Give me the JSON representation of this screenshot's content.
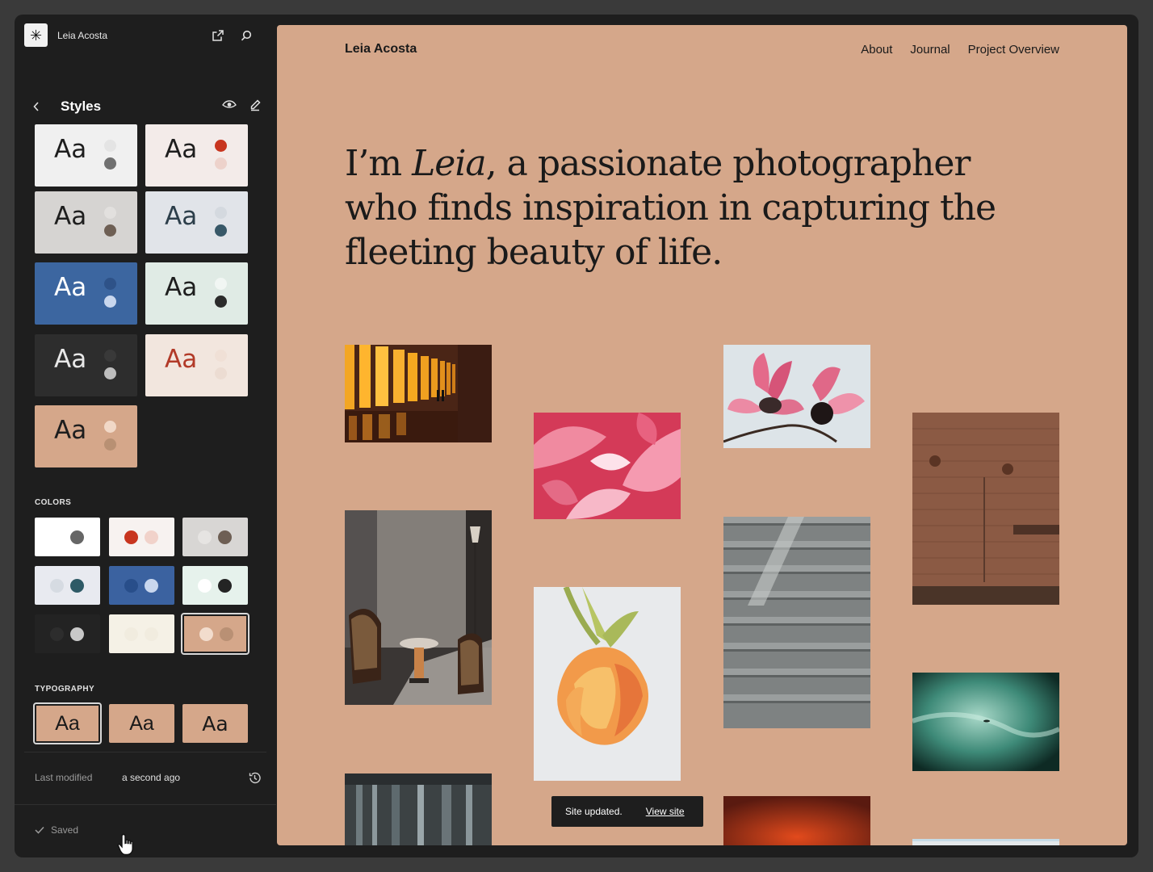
{
  "site": {
    "title": "Leia Acosta"
  },
  "panel": {
    "title": "Styles",
    "variations": [
      {
        "bg": "#f0f0f0",
        "fg": "#1e1e1e",
        "dot1": "#e4e4e4",
        "dot2": "#707070",
        "label": "Aa"
      },
      {
        "bg": "#f3ebe9",
        "fg": "#1e1e1e",
        "dot1": "#c8351f",
        "dot2": "#edd2cb",
        "label": "Aa"
      },
      {
        "bg": "#d6d4d2",
        "fg": "#1e1e1e",
        "dot1": "#e2e0de",
        "dot2": "#6e5f54",
        "label": "Aa"
      },
      {
        "bg": "#e1e4e9",
        "fg": "#2c3e4a",
        "dot1": "#d4d9df",
        "dot2": "#385868",
        "label": "Aa"
      },
      {
        "bg": "#3c66a0",
        "fg": "#ffffff",
        "dot1": "#2e5288",
        "dot2": "#c9d7ee",
        "label": "Aa"
      },
      {
        "bg": "#e0ebe5",
        "fg": "#1e1e1e",
        "dot1": "#f1f6f3",
        "dot2": "#2b2b2b",
        "label": "Aa"
      },
      {
        "bg": "#2d2d2d",
        "fg": "#e8e8e8",
        "dot1": "#393939",
        "dot2": "#bdbdbd",
        "label": "Aa"
      },
      {
        "bg": "#f2e6de",
        "fg": "#b23a28",
        "dot1": "#f0e0d6",
        "dot2": "#ecdcd2",
        "label": "Aa"
      },
      {
        "bg": "#d5a78a",
        "fg": "#1e1e1e",
        "dot1": "#f1d8c7",
        "dot2": "#b89073",
        "label": "Aa"
      }
    ],
    "colors_label": "COLORS",
    "palettes": [
      {
        "bg": "#ffffff",
        "c1": "#ffffff",
        "c2": "#666666"
      },
      {
        "bg": "#f7f2f0",
        "c1": "#c8351f",
        "c2": "#f1d2ca"
      },
      {
        "bg": "#d8d6d4",
        "c1": "#e6e4e2",
        "c2": "#6e5f54"
      },
      {
        "bg": "#e8eaf0",
        "c1": "#d6dbe2",
        "c2": "#2e5a66"
      },
      {
        "bg": "#3b62a0",
        "c1": "#284e8a",
        "c2": "#c9d7ee"
      },
      {
        "bg": "#e6f2ec",
        "c1": "#ffffff",
        "c2": "#242424"
      },
      {
        "bg": "#232323",
        "c1": "#2d2d2d",
        "c2": "#c8c8c8"
      },
      {
        "bg": "#f5f1e6",
        "c1": "#f1ecdf",
        "c2": "#f1ecdf"
      },
      {
        "bg": "#d5a78a",
        "c1": "#f2dccd",
        "c2": "#b99074"
      }
    ],
    "typography_label": "TYPOGRAPHY",
    "typography": [
      "Aa",
      "Aa",
      "Aa"
    ],
    "last_modified_label": "Last modified",
    "last_modified_value": "a second ago",
    "saved_label": "Saved"
  },
  "canvas": {
    "nav": [
      "About",
      "Journal",
      "Project Overview"
    ],
    "hero_before": "I’m ",
    "hero_em": "Leia",
    "hero_after": ", a passionate photographer who finds inspiration in capturing the fleeting beauty of life.",
    "snackbar_text": "Site updated.",
    "snackbar_link": "View site"
  },
  "icons": {
    "logo": "sparkle-logo-icon",
    "open": "external-link-icon",
    "search": "search-icon",
    "back": "chevron-left-icon",
    "preview": "eye-icon",
    "edit": "pencil-icon",
    "history": "history-icon",
    "saved": "check-icon",
    "cursor": "hand-pointer-icon"
  }
}
